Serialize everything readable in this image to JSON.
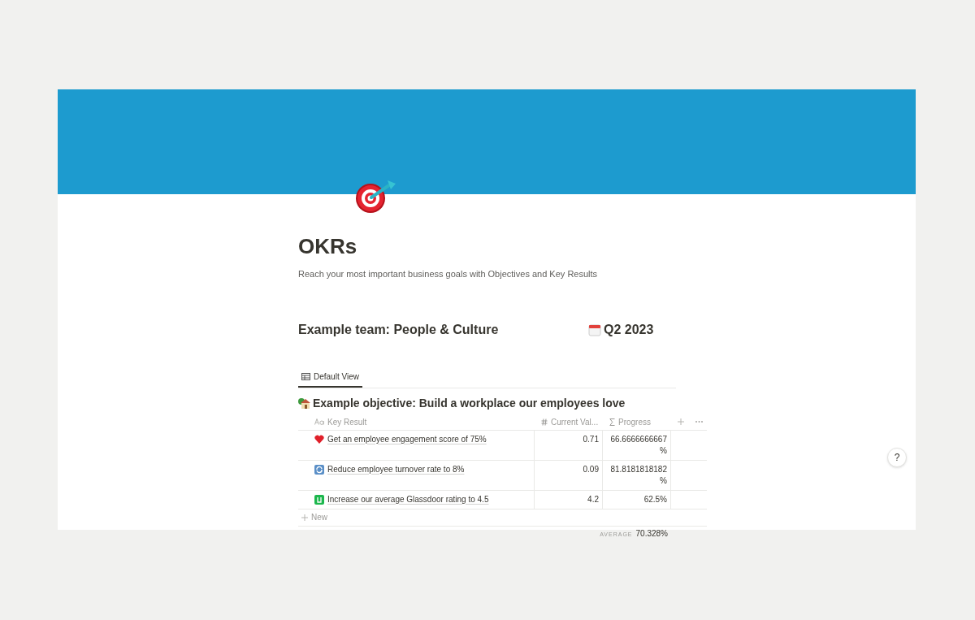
{
  "page": {
    "title": "OKRs",
    "description": "Reach your most important business goals with Objectives and Key Results"
  },
  "team": {
    "name": "Example team: People & Culture",
    "quarter": "Q2 2023"
  },
  "views": [
    {
      "label": "Default View",
      "selected": true
    }
  ],
  "objective": {
    "title": "Example objective: Build a workplace our employees love"
  },
  "table": {
    "columns": [
      {
        "label": "Key Result",
        "kind": "title"
      },
      {
        "label": "Current Val...",
        "kind": "number"
      },
      {
        "label": "Progress",
        "kind": "formula"
      }
    ],
    "rows": [
      {
        "key_result": "Get an employee engagement score of 75%",
        "current_value": "0.71",
        "progress": "66.6666666667 %"
      },
      {
        "key_result": "Reduce employee turnover rate to 8%",
        "current_value": "0.09",
        "progress": "81.8181818182 %"
      },
      {
        "key_result": "Increase our average Glassdoor rating to 4.5",
        "current_value": "4.2",
        "progress": "62.5%"
      }
    ],
    "new_row": "New",
    "summary": {
      "label": "AVERAGE",
      "value": "70.328%"
    }
  },
  "help_button": "?"
}
